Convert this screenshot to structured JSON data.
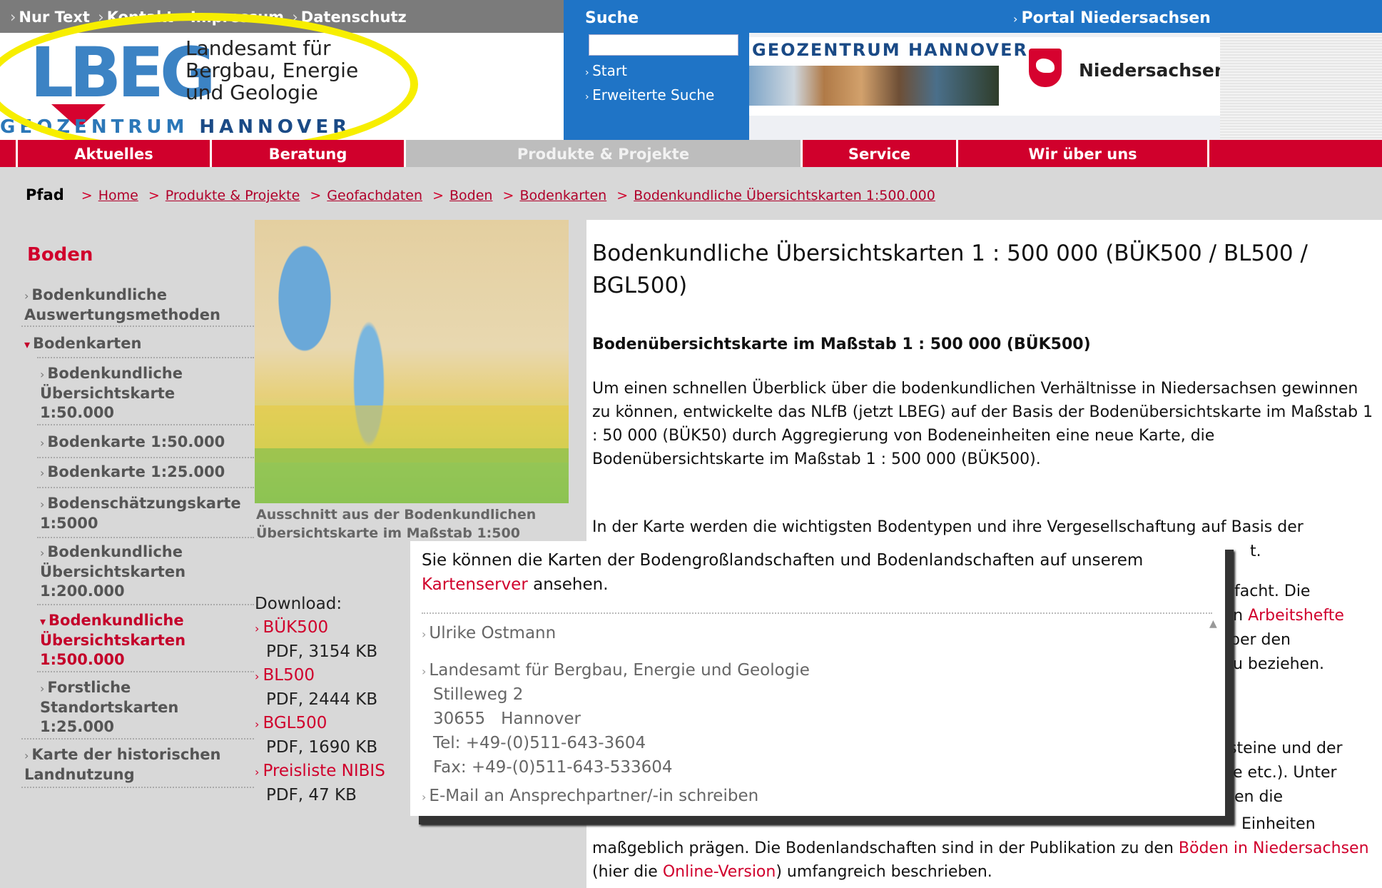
{
  "top_links": [
    "Nur Text",
    "Kontakt",
    "Impressum",
    "Datenschutz"
  ],
  "logo": {
    "letters": "LBEG",
    "name_lines": [
      "Landesamt für",
      "Bergbau, Energie",
      "und Geologie"
    ],
    "geozentrum_1": "GEOZENTRUM",
    "geozentrum_2": "HANNOVER"
  },
  "search": {
    "label": "Suche",
    "value": "",
    "links": [
      "Start",
      "Erweiterte Suche"
    ]
  },
  "portal_link": "Portal Niedersachsen",
  "banner": {
    "title": "GEOZENTRUM HANNOVER",
    "state": "Niedersachsen"
  },
  "tabs": [
    "Aktuelles",
    "Beratung",
    "Produkte & Projekte",
    "Service",
    "Wir über uns"
  ],
  "breadcrumb": {
    "label": "Pfad",
    "items": [
      "Home",
      "Produkte & Projekte",
      "Geofachdaten",
      "Boden",
      "Bodenkarten",
      "Bodenkundliche Übersichtskarten 1:500.000"
    ]
  },
  "sidebar": {
    "title": "Boden",
    "items": [
      {
        "label": "Bodenkundliche Auswertungsmethoden"
      },
      {
        "label": "Bodenkarten"
      },
      {
        "label": "Bodenkundliche Übersichtskarte 1:50.000"
      },
      {
        "label": "Bodenkarte 1:50.000"
      },
      {
        "label": "Bodenkarte 1:25.000"
      },
      {
        "label": "Bodenschätzungskarte 1:5000"
      },
      {
        "label": "Bodenkundliche Übersichtskarten 1:200.000"
      },
      {
        "label": "Bodenkundliche Übersichtskarten 1:500.000"
      },
      {
        "label": "Forstliche Standortskarten 1:25.000"
      },
      {
        "label": "Karte der historischen Landnutzung"
      }
    ]
  },
  "image_caption": "Ausschnitt aus der Bodenkundlichen Übersichtskarte im Maßstab 1:500",
  "downloads": {
    "label": "Download:",
    "items": [
      {
        "name": "BÜK500",
        "size": "PDF, 3154 KB"
      },
      {
        "name": "BL500",
        "size": "PDF, 2444 KB"
      },
      {
        "name": "BGL500",
        "size": "PDF, 1690 KB"
      },
      {
        "name": "Preisliste NIBIS",
        "size": "PDF, 47 KB"
      }
    ]
  },
  "main": {
    "title": "Bodenkundliche Übersichtskarten 1 : 500 000 (BÜK500 / BL500 / BGL500)",
    "subtitle": "Bodenübersichtskarte im Maßstab 1 : 500 000 (BÜK500)",
    "para1": "Um einen schnellen Überblick über die bodenkundlichen Verhältnisse in Niedersachsen gewinnen zu können, entwickelte das NLfB (jetzt LBEG) auf der Basis der Bodenübersichtskarte im Maßstab 1 : 50 000 (BÜK50) durch Aggregierung von Bodeneinheiten eine neue Karte, die Bodenübersichtskarte im Maßstab 1 : 500 000 (BÜK500).",
    "para2": "In der Karte werden die wichtigsten Bodentypen und ihre Vergesellschaftung auf Basis der",
    "frag_t": "t.",
    "frag_vereinfacht": "facht. Die",
    "frag_in": "in",
    "frag_arbeitshefte": "Arbeitshefte",
    "frag_ber": "ber den",
    "frag_beziehen": "u beziehen.",
    "frag_steine": "steine und der",
    "frag_etc": "e etc.). Unter",
    "frag_die": "en die",
    "frag_einheiten": "Einheiten",
    "para_last_1": "maßgeblich prägen. Die Bodenlandschaften sind in der Publikation zu den",
    "link_boeden": "Böden in Niedersachsen",
    "para_last_2": "(hier die",
    "link_online": "Online-Version",
    "para_last_3": ") umfangreich beschrieben."
  },
  "popup": {
    "text_before": "Sie können die Karten der Bodengroßlandschaften und Bodenlandschaften auf unserem",
    "link": "Kartenserver",
    "text_after": "ansehen.",
    "contact_name": "Ulrike Ostmann",
    "org": "Landesamt für Bergbau, Energie und Geologie",
    "street": "Stilleweg 2",
    "city": "30655   Hannover",
    "tel": "Tel: +49-(0)511-643-3604",
    "fax": "Fax: +49-(0)511-643-533604",
    "email_link": "E-Mail an Ansprechpartner/-in schreiben"
  },
  "colors": {
    "brand_red": "#d0002c",
    "brand_blue": "#1f74c6",
    "highlight_yellow": "#f7ee00"
  }
}
